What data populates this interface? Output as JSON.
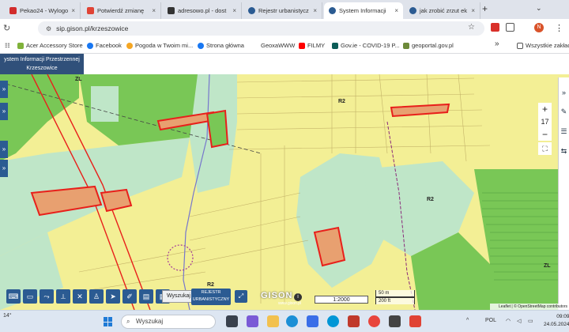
{
  "browser": {
    "tabs": [
      {
        "title": "Pekao24 - Wylogo",
        "favicon_color": "#d22c2c"
      },
      {
        "title": "Potwierdź zmianę",
        "favicon_color": "#e04335"
      },
      {
        "title": "adresowo.pl - dost",
        "favicon_color": "#333333"
      },
      {
        "title": "Rejestr urbanistycz",
        "favicon_color": "#2b5b92"
      },
      {
        "title": "System Informacji",
        "favicon_color": "#2b5b92",
        "active": true
      },
      {
        "title": "jak zrobić zrzut ek",
        "favicon_color": "#2b5b92"
      }
    ],
    "close_glyph": "×",
    "new_tab_glyph": "+",
    "url": "sip.gison.pl/krzeszowice",
    "profile_initial": "N"
  },
  "bookmarks": [
    {
      "label": "Acer Accessory Store",
      "icon_color": "#80b23a"
    },
    {
      "label": "Facebook",
      "icon_color": "#1877f2"
    },
    {
      "label": "Pogoda w Twoim mi...",
      "icon_color": "#f5a623"
    },
    {
      "label": "Strona główna",
      "icon_color": "#1877f2"
    },
    {
      "label": "GeoxaWWW",
      "icon_color": ""
    },
    {
      "label": "FILMY",
      "icon_color": "#ff0000"
    },
    {
      "label": "Gov.ie - COVID-19 P...",
      "icon_color": "#0b5c57"
    },
    {
      "label": "geoportal.gov.pl",
      "icon_color": "#6d8a3a"
    }
  ],
  "bookmarks_more": "»",
  "bookmarks_folder": "Wszystkie zakład",
  "site": {
    "title_line1": "ystem Informacji Przestrzennej",
    "title_line2": "Krzeszowice"
  },
  "map": {
    "zoom_in": "+",
    "zoom_level": "17",
    "zoom_out": "−",
    "search_button": "Wyszukaj",
    "register_line1": "REJESTR",
    "register_line2": "URBANISTYCZNY",
    "brand": "GISON",
    "brand_url": "www.gison.pl",
    "scale": "1:2000",
    "scalebar_m": "50 m",
    "scalebar_ft": "200 ft",
    "attribution": "Leaflet | © OpenStreetMap contributors",
    "zone_labels": [
      "R2",
      "R2",
      "ZL",
      "ZL",
      "R2"
    ],
    "colors": {
      "forest": "#79c756",
      "meadow": "#bfe6c8",
      "agricultural": "#f3ef95",
      "selected_border": "#e8201b",
      "selected_fill": "#e8a070"
    }
  },
  "taskbar": {
    "temperature": "14°",
    "search_placeholder": "Wyszukaj",
    "language": "POL",
    "time": "09:09",
    "date": "24.05.2024"
  }
}
